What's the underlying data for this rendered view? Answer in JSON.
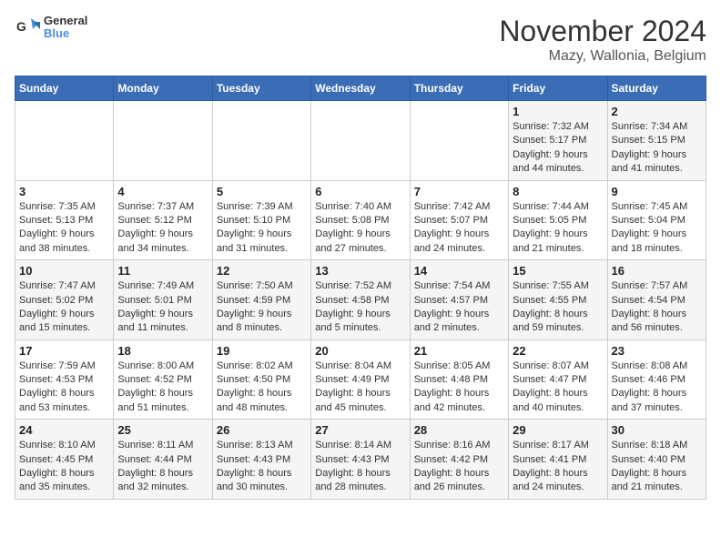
{
  "header": {
    "logo": {
      "line1": "General",
      "line2": "Blue"
    },
    "title": "November 2024",
    "subtitle": "Mazy, Wallonia, Belgium"
  },
  "calendar": {
    "days_of_week": [
      "Sunday",
      "Monday",
      "Tuesday",
      "Wednesday",
      "Thursday",
      "Friday",
      "Saturday"
    ],
    "weeks": [
      {
        "cells": [
          {
            "day": null,
            "info": null
          },
          {
            "day": null,
            "info": null
          },
          {
            "day": null,
            "info": null
          },
          {
            "day": null,
            "info": null
          },
          {
            "day": null,
            "info": null
          },
          {
            "day": "1",
            "info": "Sunrise: 7:32 AM\nSunset: 5:17 PM\nDaylight: 9 hours and 44 minutes."
          },
          {
            "day": "2",
            "info": "Sunrise: 7:34 AM\nSunset: 5:15 PM\nDaylight: 9 hours and 41 minutes."
          }
        ]
      },
      {
        "cells": [
          {
            "day": "3",
            "info": "Sunrise: 7:35 AM\nSunset: 5:13 PM\nDaylight: 9 hours and 38 minutes."
          },
          {
            "day": "4",
            "info": "Sunrise: 7:37 AM\nSunset: 5:12 PM\nDaylight: 9 hours and 34 minutes."
          },
          {
            "day": "5",
            "info": "Sunrise: 7:39 AM\nSunset: 5:10 PM\nDaylight: 9 hours and 31 minutes."
          },
          {
            "day": "6",
            "info": "Sunrise: 7:40 AM\nSunset: 5:08 PM\nDaylight: 9 hours and 27 minutes."
          },
          {
            "day": "7",
            "info": "Sunrise: 7:42 AM\nSunset: 5:07 PM\nDaylight: 9 hours and 24 minutes."
          },
          {
            "day": "8",
            "info": "Sunrise: 7:44 AM\nSunset: 5:05 PM\nDaylight: 9 hours and 21 minutes."
          },
          {
            "day": "9",
            "info": "Sunrise: 7:45 AM\nSunset: 5:04 PM\nDaylight: 9 hours and 18 minutes."
          }
        ]
      },
      {
        "cells": [
          {
            "day": "10",
            "info": "Sunrise: 7:47 AM\nSunset: 5:02 PM\nDaylight: 9 hours and 15 minutes."
          },
          {
            "day": "11",
            "info": "Sunrise: 7:49 AM\nSunset: 5:01 PM\nDaylight: 9 hours and 11 minutes."
          },
          {
            "day": "12",
            "info": "Sunrise: 7:50 AM\nSunset: 4:59 PM\nDaylight: 9 hours and 8 minutes."
          },
          {
            "day": "13",
            "info": "Sunrise: 7:52 AM\nSunset: 4:58 PM\nDaylight: 9 hours and 5 minutes."
          },
          {
            "day": "14",
            "info": "Sunrise: 7:54 AM\nSunset: 4:57 PM\nDaylight: 9 hours and 2 minutes."
          },
          {
            "day": "15",
            "info": "Sunrise: 7:55 AM\nSunset: 4:55 PM\nDaylight: 8 hours and 59 minutes."
          },
          {
            "day": "16",
            "info": "Sunrise: 7:57 AM\nSunset: 4:54 PM\nDaylight: 8 hours and 56 minutes."
          }
        ]
      },
      {
        "cells": [
          {
            "day": "17",
            "info": "Sunrise: 7:59 AM\nSunset: 4:53 PM\nDaylight: 8 hours and 53 minutes."
          },
          {
            "day": "18",
            "info": "Sunrise: 8:00 AM\nSunset: 4:52 PM\nDaylight: 8 hours and 51 minutes."
          },
          {
            "day": "19",
            "info": "Sunrise: 8:02 AM\nSunset: 4:50 PM\nDaylight: 8 hours and 48 minutes."
          },
          {
            "day": "20",
            "info": "Sunrise: 8:04 AM\nSunset: 4:49 PM\nDaylight: 8 hours and 45 minutes."
          },
          {
            "day": "21",
            "info": "Sunrise: 8:05 AM\nSunset: 4:48 PM\nDaylight: 8 hours and 42 minutes."
          },
          {
            "day": "22",
            "info": "Sunrise: 8:07 AM\nSunset: 4:47 PM\nDaylight: 8 hours and 40 minutes."
          },
          {
            "day": "23",
            "info": "Sunrise: 8:08 AM\nSunset: 4:46 PM\nDaylight: 8 hours and 37 minutes."
          }
        ]
      },
      {
        "cells": [
          {
            "day": "24",
            "info": "Sunrise: 8:10 AM\nSunset: 4:45 PM\nDaylight: 8 hours and 35 minutes."
          },
          {
            "day": "25",
            "info": "Sunrise: 8:11 AM\nSunset: 4:44 PM\nDaylight: 8 hours and 32 minutes."
          },
          {
            "day": "26",
            "info": "Sunrise: 8:13 AM\nSunset: 4:43 PM\nDaylight: 8 hours and 30 minutes."
          },
          {
            "day": "27",
            "info": "Sunrise: 8:14 AM\nSunset: 4:43 PM\nDaylight: 8 hours and 28 minutes."
          },
          {
            "day": "28",
            "info": "Sunrise: 8:16 AM\nSunset: 4:42 PM\nDaylight: 8 hours and 26 minutes."
          },
          {
            "day": "29",
            "info": "Sunrise: 8:17 AM\nSunset: 4:41 PM\nDaylight: 8 hours and 24 minutes."
          },
          {
            "day": "30",
            "info": "Sunrise: 8:18 AM\nSunset: 4:40 PM\nDaylight: 8 hours and 21 minutes."
          }
        ]
      }
    ]
  }
}
